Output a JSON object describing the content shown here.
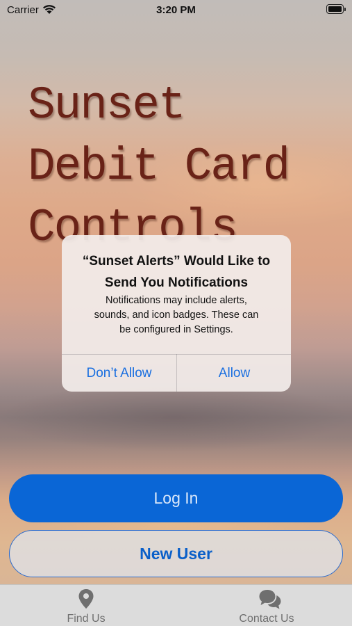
{
  "status_bar": {
    "carrier": "Carrier",
    "time": "3:20 PM"
  },
  "title": {
    "line1": "Sunset",
    "line2": "Debit Card",
    "line3": "Controls"
  },
  "alert": {
    "title_line1": "“Sunset Alerts” Would Like to",
    "title_line2": "Send You Notifications",
    "message_line1": "Notifications may include alerts,",
    "message_line2": "sounds, and icon badges. These can",
    "message_line3": "be configured in Settings.",
    "deny_label": "Don’t Allow",
    "allow_label": "Allow"
  },
  "buttons": {
    "login_label": "Log In",
    "new_user_label": "New User"
  },
  "tab_bar": {
    "items": [
      {
        "label": "Find Us",
        "icon": "location-pin-icon"
      },
      {
        "label": "Contact Us",
        "icon": "chat-bubbles-icon"
      }
    ]
  },
  "colors": {
    "accent": "#0a66d6",
    "title_color": "#6e2418",
    "alert_button_color": "#1a6fe0"
  }
}
